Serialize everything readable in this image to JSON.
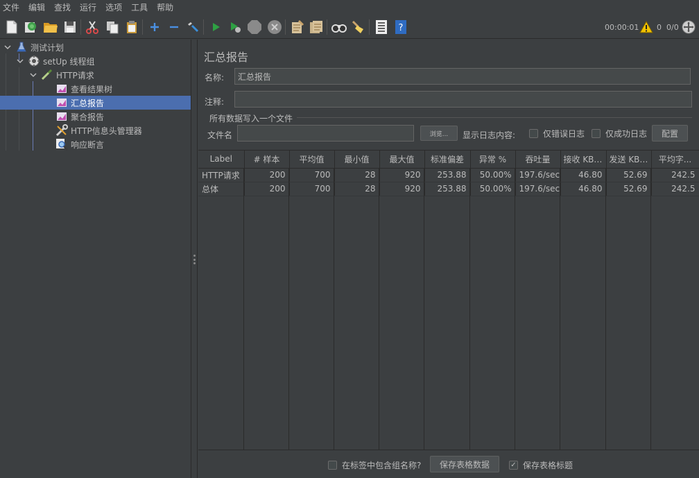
{
  "menu": [
    "文件",
    "编辑",
    "查找",
    "运行",
    "选项",
    "工具",
    "帮助"
  ],
  "toolbar": {
    "buttons": [
      {
        "name": "new-icon",
        "color": "#e8e8e8"
      },
      {
        "name": "templates-icon",
        "color": "#4aa84a"
      },
      {
        "name": "open-icon",
        "color": "#e6b03a"
      },
      {
        "name": "save-icon",
        "color": "#cfcfcf"
      },
      {
        "name": "cut-icon",
        "color": "#d94a4a"
      },
      {
        "name": "copy-icon",
        "color": "#d8d8d8"
      },
      {
        "name": "paste-icon",
        "color": "#e6c35a"
      },
      {
        "name": "expand-icon",
        "color": "#4a90e2"
      },
      {
        "name": "collapse-icon",
        "color": "#4a90e2"
      },
      {
        "name": "toggle-icon",
        "color": "#9aa3ad"
      },
      {
        "name": "start-icon",
        "color": "#2ea043"
      },
      {
        "name": "start-no-pause-icon",
        "color": "#2ea043"
      },
      {
        "name": "stop-icon",
        "color": "#8a8a8a"
      },
      {
        "name": "shutdown-icon",
        "color": "#8a8a8a"
      },
      {
        "name": "clear-icon",
        "color": "#c9a36b"
      },
      {
        "name": "clear-all-icon",
        "color": "#c9a36b"
      },
      {
        "name": "search-icon",
        "color": "#cccccc"
      },
      {
        "name": "reset-search-icon",
        "color": "#e6c35a"
      },
      {
        "name": "function-helper-icon",
        "color": "#d8d8d8"
      },
      {
        "name": "help-icon",
        "color": "#4a90e2"
      }
    ],
    "elapsed": "00:00:01",
    "warnings": "0",
    "threads": "0/0"
  },
  "tree": {
    "items": [
      {
        "label": "测试计划",
        "icon": "flask-icon"
      },
      {
        "label": "setUp 线程组",
        "icon": "gear-icon"
      },
      {
        "label": "HTTP请求",
        "icon": "pipette-icon"
      },
      {
        "label": "查看结果树",
        "icon": "chart-icon"
      },
      {
        "label": "汇总报告",
        "icon": "chart-icon"
      },
      {
        "label": "聚合报告",
        "icon": "chart-icon"
      },
      {
        "label": "HTTP信息头管理器",
        "icon": "wrench-icon"
      },
      {
        "label": "响应断言",
        "icon": "magnifier-icon"
      }
    ]
  },
  "panel": {
    "title": "汇总报告",
    "name_label": "名称:",
    "name_value": "汇总报告",
    "comment_label": "注释:",
    "comment_value": "",
    "file_group_title": "所有数据写入一个文件",
    "filename_label": "文件名",
    "filename_value": "",
    "browse_label": "浏览...",
    "log_label": "显示日志内容:",
    "errors_only_label": "仅错误日志",
    "success_only_label": "仅成功日志",
    "configure_label": "配置"
  },
  "table": {
    "headers": [
      "Label",
      "# 样本",
      "平均值",
      "最小值",
      "最大值",
      "标准偏差",
      "异常 %",
      "吞吐量",
      "接收 KB/...",
      "发送 KB/...",
      "平均字..."
    ],
    "rows": [
      [
        "HTTP请求",
        "200",
        "700",
        "28",
        "920",
        "253.88",
        "50.00%",
        "197.6/sec",
        "46.80",
        "52.69",
        "242.5"
      ],
      [
        "总体",
        "200",
        "700",
        "28",
        "920",
        "253.88",
        "50.00%",
        "197.6/sec",
        "46.80",
        "52.69",
        "242.5"
      ]
    ]
  },
  "footer": {
    "include_group_label": "在标签中包含组名称?",
    "save_table_label": "保存表格数据",
    "save_header_label": "保存表格标题",
    "save_header_checked": true
  }
}
